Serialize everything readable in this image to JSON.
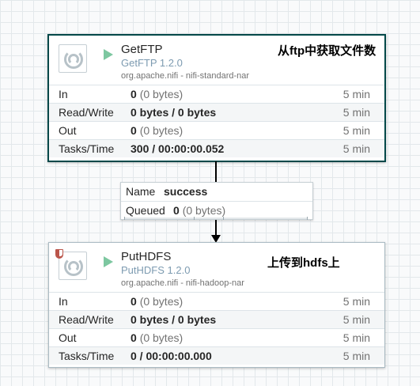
{
  "processors": [
    {
      "name": "GetFTP",
      "type": "GetFTP 1.2.0",
      "bundle": "org.apache.nifi - nifi-standard-nar",
      "note": "从ftp中获取文件数",
      "in": {
        "label": "In",
        "value": "0",
        "sub": "(0 bytes)",
        "period": "5 min"
      },
      "readwrite": {
        "label": "Read/Write",
        "value": "0 bytes / 0 bytes",
        "period": "5 min"
      },
      "out": {
        "label": "Out",
        "value": "0",
        "sub": "(0 bytes)",
        "period": "5 min"
      },
      "tasks": {
        "label": "Tasks/Time",
        "value": "300 / 00:00:00.052",
        "period": "5 min"
      }
    },
    {
      "name": "PutHDFS",
      "type": "PutHDFS 1.2.0",
      "bundle": "org.apache.nifi - nifi-hadoop-nar",
      "note": "上传到hdfs上",
      "in": {
        "label": "In",
        "value": "0",
        "sub": "(0 bytes)",
        "period": "5 min"
      },
      "readwrite": {
        "label": "Read/Write",
        "value": "0 bytes / 0 bytes",
        "period": "5 min"
      },
      "out": {
        "label": "Out",
        "value": "0",
        "sub": "(0 bytes)",
        "period": "5 min"
      },
      "tasks": {
        "label": "Tasks/Time",
        "value": "0 / 00:00:00.000",
        "period": "5 min"
      }
    }
  ],
  "connection": {
    "name_label": "Name",
    "name_value": "success",
    "queued_label": "Queued",
    "queued_value": "0",
    "queued_sub": "(0 bytes)"
  },
  "icons": {
    "processor": "processor-icon",
    "run": "run-status-icon",
    "restricted": "restricted-shield-icon",
    "arrow": "arrow-down-icon"
  },
  "colors": {
    "selected_border": "#004849",
    "running": "#7dc7a0",
    "type_text": "#7d9bb1",
    "restricted": "#ba554a"
  }
}
